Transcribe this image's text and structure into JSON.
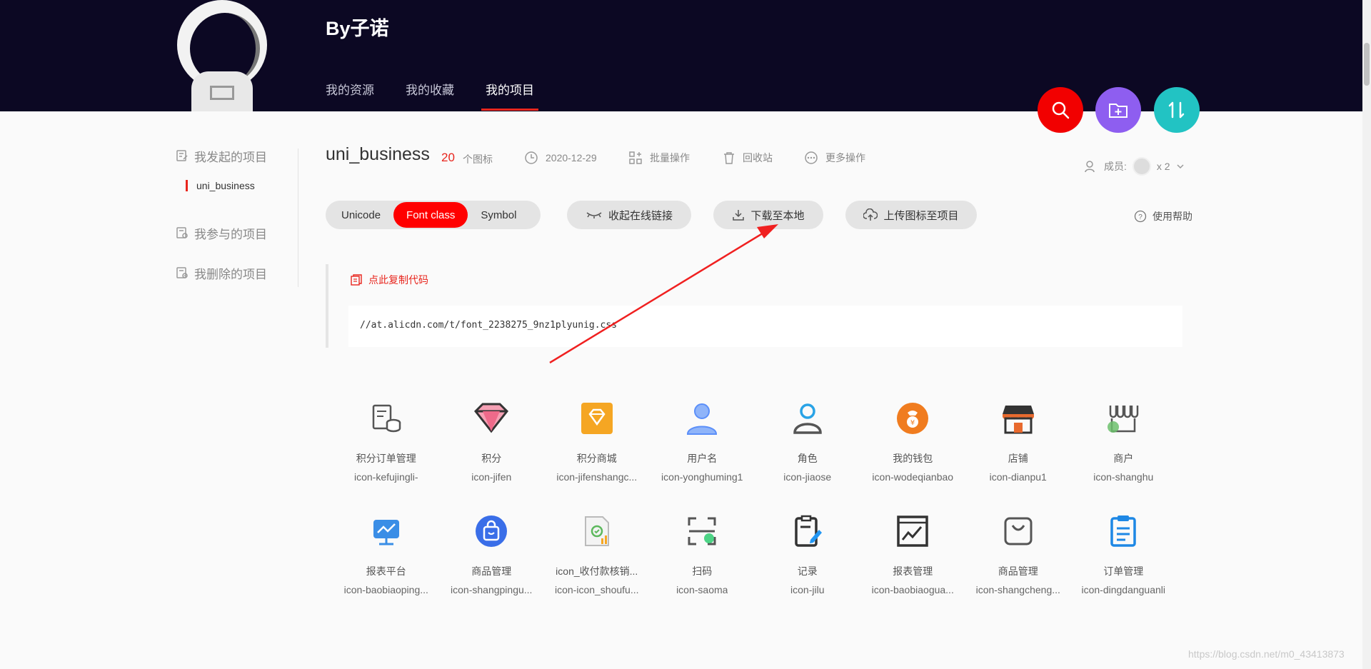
{
  "header": {
    "brand": "By子诺",
    "nav": [
      {
        "label": "我的资源"
      },
      {
        "label": "我的收藏"
      },
      {
        "label": "我的项目"
      }
    ]
  },
  "sidebar": {
    "items": [
      {
        "label": "我发起的项目",
        "icon": "project-start-icon"
      },
      {
        "label": "我参与的项目",
        "icon": "project-join-icon"
      },
      {
        "label": "我删除的项目",
        "icon": "project-delete-icon"
      }
    ],
    "sub_item": "uni_business"
  },
  "project": {
    "title": "uni_business",
    "count": "20",
    "count_unit": "个图标",
    "date": "2020-12-29",
    "batch": "批量操作",
    "recycle": "回收站",
    "more": "更多操作",
    "members_label": "成员:",
    "members_count": "x 2"
  },
  "toolbar": {
    "segments": [
      "Unicode",
      "Font class",
      "Symbol"
    ],
    "active_segment": "Font class",
    "collapse_link": "收起在线链接",
    "download": "下载至本地",
    "upload": "上传图标至项目",
    "help": "使用帮助"
  },
  "code": {
    "copy_label": "点此复制代码",
    "url": "//at.alicdn.com/t/font_2238275_9nz1plyunig.css"
  },
  "icons": [
    {
      "name": "积分订单管理",
      "code": "icon-kefujingli-",
      "color": "#555555"
    },
    {
      "name": "积分",
      "code": "icon-jifen",
      "color": "#f06b8a"
    },
    {
      "name": "积分商城",
      "code": "icon-jifenshangc...",
      "color": "#f5a623"
    },
    {
      "name": "用户名",
      "code": "icon-yonghuming1",
      "color": "#5b8ff9"
    },
    {
      "name": "角色",
      "code": "icon-jiaose",
      "color": "#29a3e6"
    },
    {
      "name": "我的钱包",
      "code": "icon-wodeqianbao",
      "color": "#f07c1f"
    },
    {
      "name": "店铺",
      "code": "icon-dianpu1",
      "color": "#e86a2e"
    },
    {
      "name": "商户",
      "code": "icon-shanghu",
      "color": "#4caf50"
    },
    {
      "name": "报表平台",
      "code": "icon-baobiaoping...",
      "color": "#3a8ee6"
    },
    {
      "name": "商品管理",
      "code": "icon-shangpingu...",
      "color": "#3a6ee8"
    },
    {
      "name": "icon_收付款核销...",
      "code": "icon-icon_shoufu...",
      "color": "#5cb85c"
    },
    {
      "name": "扫码",
      "code": "icon-saoma",
      "color": "#2ecc71"
    },
    {
      "name": "记录",
      "code": "icon-jilu",
      "color": "#2196f3"
    },
    {
      "name": "报表管理",
      "code": "icon-baobiaogua...",
      "color": "#333333"
    },
    {
      "name": "商品管理",
      "code": "icon-shangcheng...",
      "color": "#555555"
    },
    {
      "name": "订单管理",
      "code": "icon-dingdanguanli",
      "color": "#1e88e5"
    }
  ],
  "watermark": "https://blog.csdn.net/m0_43413873",
  "colors": {
    "header_bg": "#0c0823",
    "accent_red": "#ff0000",
    "fab_search": "#f20000",
    "fab_folder": "#8e5ef0",
    "fab_sort": "#22c3c3"
  }
}
